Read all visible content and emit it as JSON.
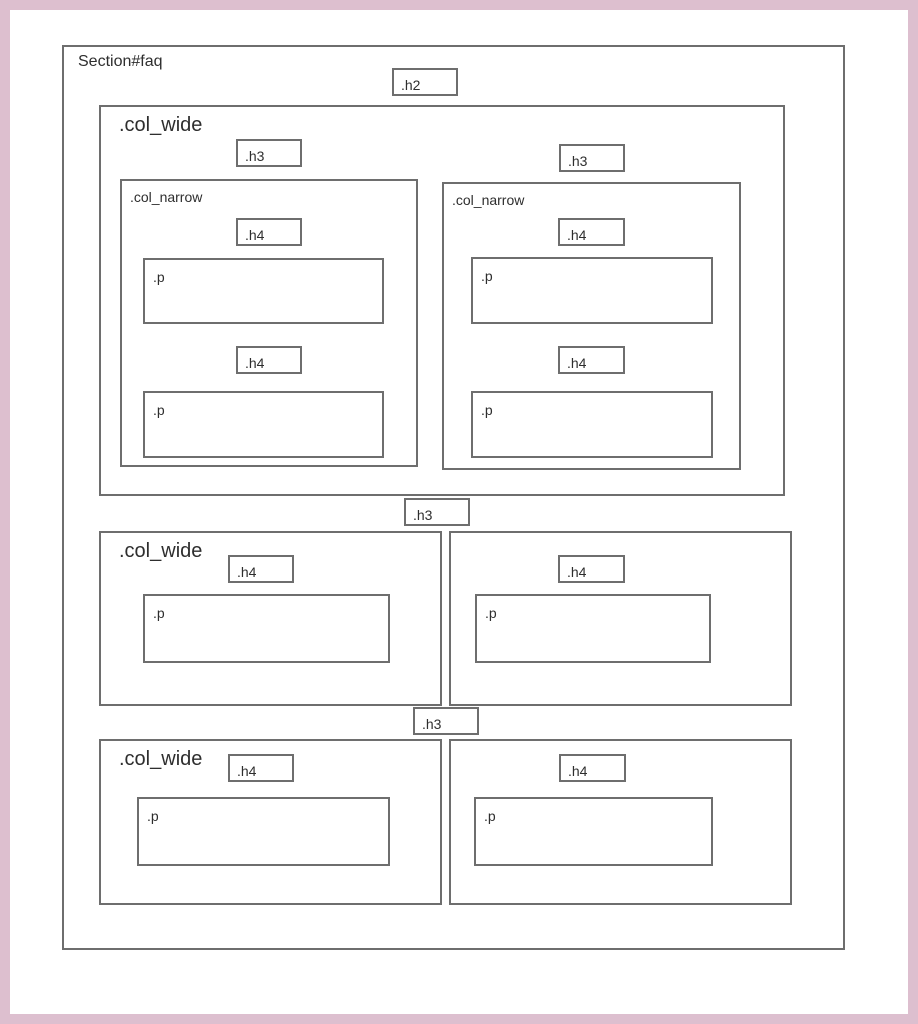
{
  "diagram": {
    "colors": {
      "frame": "#ddbfcf",
      "border": "#6e6e6e",
      "text": "#2e2e2e"
    },
    "section_label": "Section#faq",
    "h2_label": ".h2",
    "top_wide": {
      "label": ".col_wide",
      "h3_left": ".h3",
      "h3_right": ".h3",
      "narrow_left": {
        "label": ".col_narrow",
        "h4_1": ".h4",
        "p_1": ".p",
        "h4_2": ".h4",
        "p_2": ".p"
      },
      "narrow_right": {
        "label": ".col_narrow",
        "h4_1": ".h4",
        "p_1": ".p",
        "h4_2": ".h4",
        "p_2": ".p"
      }
    },
    "group2": {
      "h3": ".h3",
      "left": {
        "label": ".col_wide",
        "h4": ".h4",
        "p": ".p"
      },
      "right": {
        "h4": ".h4",
        "p": ".p"
      }
    },
    "group3": {
      "h3": ".h3",
      "left": {
        "label": ".col_wide",
        "h4": ".h4",
        "p": ".p"
      },
      "right": {
        "h4": ".h4",
        "p": ".p"
      }
    }
  }
}
